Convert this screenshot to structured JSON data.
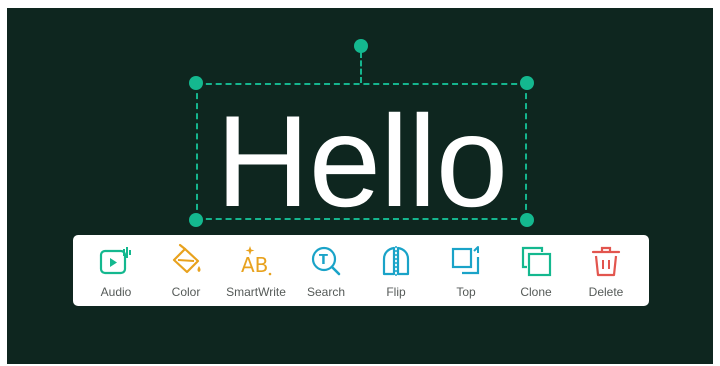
{
  "canvas": {
    "text": "Hello",
    "background": "#0e261f",
    "accent": "#14b88f"
  },
  "toolbar": {
    "items": [
      {
        "label": "Audio",
        "icon": "audio-icon",
        "color": "#14b88f"
      },
      {
        "label": "Color",
        "icon": "paint-bucket-icon",
        "color": "#e8a21e"
      },
      {
        "label": "SmartWrite",
        "icon": "smartwrite-icon",
        "color": "#e8a21e"
      },
      {
        "label": "Search",
        "icon": "search-icon",
        "color": "#1aa3c8"
      },
      {
        "label": "Flip",
        "icon": "flip-icon",
        "color": "#1aa3c8"
      },
      {
        "label": "Top",
        "icon": "bring-to-top-icon",
        "color": "#1aa3c8"
      },
      {
        "label": "Clone",
        "icon": "clone-icon",
        "color": "#14b88f"
      },
      {
        "label": "Delete",
        "icon": "trash-icon",
        "color": "#e2554e"
      }
    ]
  }
}
